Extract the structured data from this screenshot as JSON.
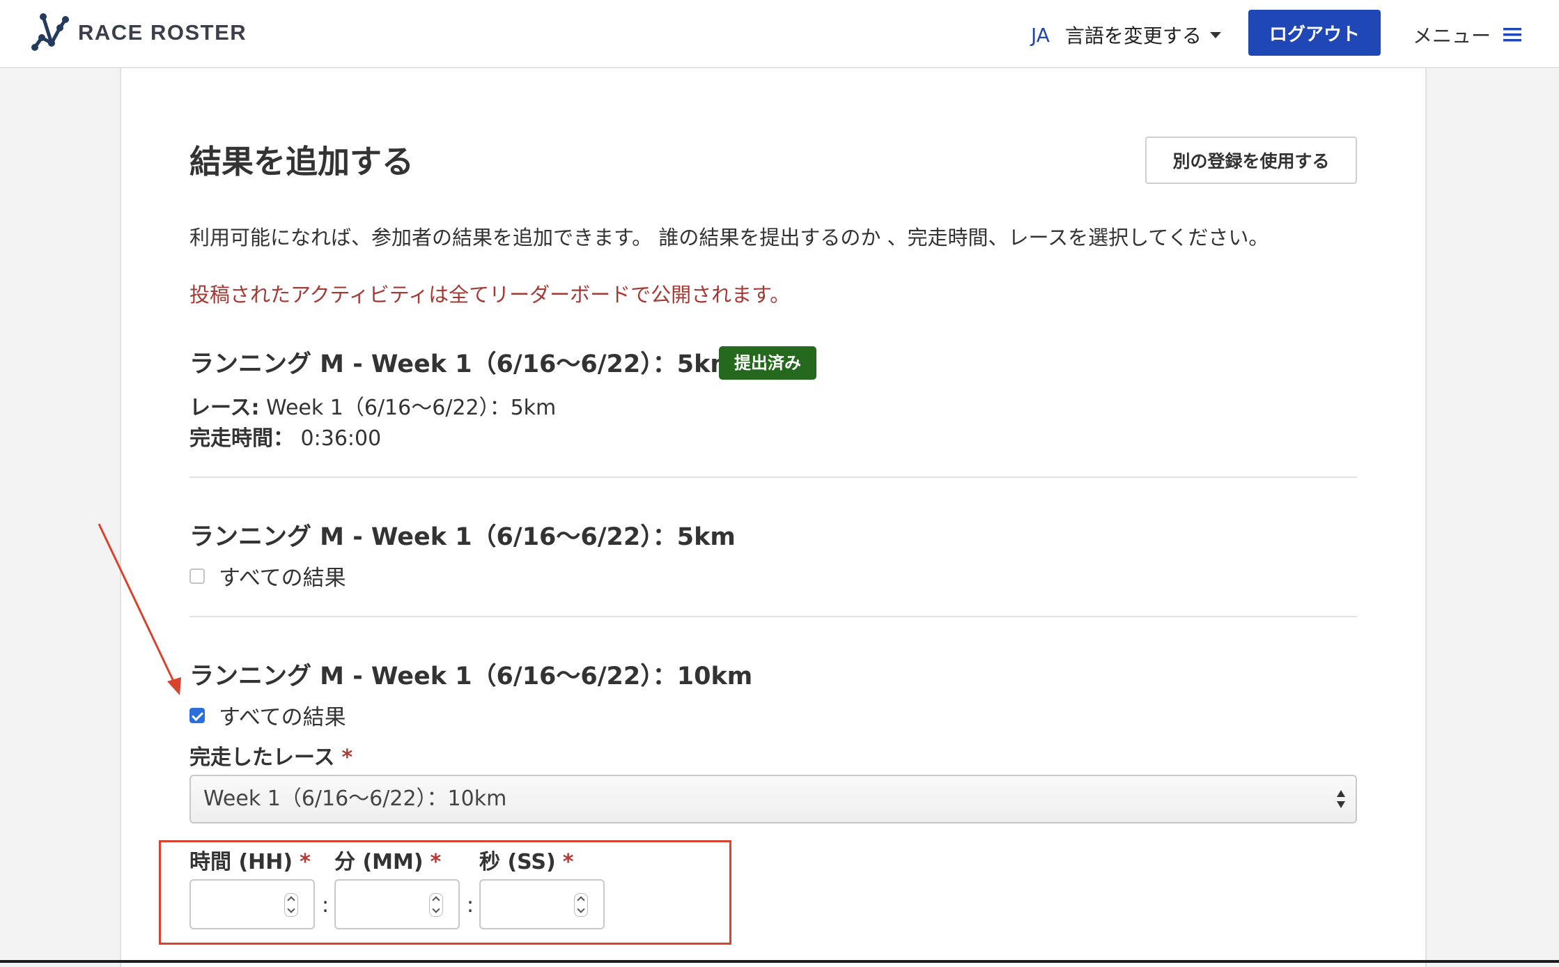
{
  "header": {
    "logo_text": "RACE ROSTER",
    "lang_code": "JA",
    "lang_label": "言語を変更する",
    "logout_label": "ログアウト",
    "menu_label": "メニュー"
  },
  "page": {
    "title": "結果を追加する",
    "alt_registration_button": "別の登録を使用する",
    "intro": "利用可能になれば、参加者の結果を追加できます。 誰の結果を提出するのか 、完走時間、レースを選択してください。",
    "notice": "投稿されたアクティビティは全てリーダーボードで公開されます。"
  },
  "sections": [
    {
      "title": "ランニング M - Week 1（6/16〜6/22）：5km",
      "badge": "提出済み",
      "race_label": "レース:",
      "race_value": "Week 1（6/16〜6/22）：5km",
      "time_label": "完走時間：",
      "time_value": "0:36:00"
    },
    {
      "title": "ランニング M - Week 1（6/16〜6/22）：5km",
      "checkbox_label": "すべての結果",
      "checked": false
    },
    {
      "title": "ランニング M - Week 1（6/16〜6/22）：10km",
      "checkbox_label": "すべての結果",
      "checked": true,
      "race_field_label": "完走したレース",
      "race_select_value": "Week 1（6/16〜6/22）：10km",
      "hours_label": "時間 (HH)",
      "minutes_label": "分 (MM)",
      "seconds_label": "秒 (SS)",
      "required_mark": "*",
      "separator": ":"
    }
  ],
  "colors": {
    "primary": "#1f47b6",
    "badge": "#25691f",
    "notice": "#a33a35",
    "annotation": "#d9432e"
  }
}
